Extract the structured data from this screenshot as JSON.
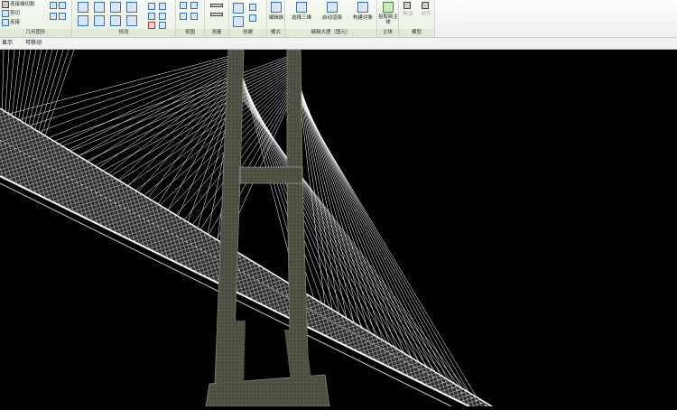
{
  "ribbon": {
    "panels": [
      {
        "label": "几何图形",
        "items": [
          "连接端切割",
          "剪切",
          "连接"
        ]
      },
      {
        "label": "修改",
        "items": []
      },
      {
        "label": "视图",
        "items": []
      },
      {
        "label": "测量",
        "items": []
      },
      {
        "label": "创建",
        "items": []
      },
      {
        "label": "模式",
        "items": [
          "编辑族"
        ]
      },
      {
        "label": "编辑大理（图元）",
        "items": [
          "选择三维",
          "启动渲染",
          "构建对象"
        ]
      },
      {
        "label": "主体",
        "items": [
          "拾取新主体"
        ]
      },
      {
        "label": "模型",
        "items": [
          "移动",
          "对齐"
        ]
      }
    ]
  },
  "options_bar": {
    "items": [
      "显示",
      "可移动"
    ]
  },
  "colors": {
    "ribbon_bg": "#eeeeee",
    "ribbon_green": "#e6eee0",
    "viewport_bg": "#000000",
    "tower": "#4b4d3f",
    "cable": "#ffffff"
  }
}
